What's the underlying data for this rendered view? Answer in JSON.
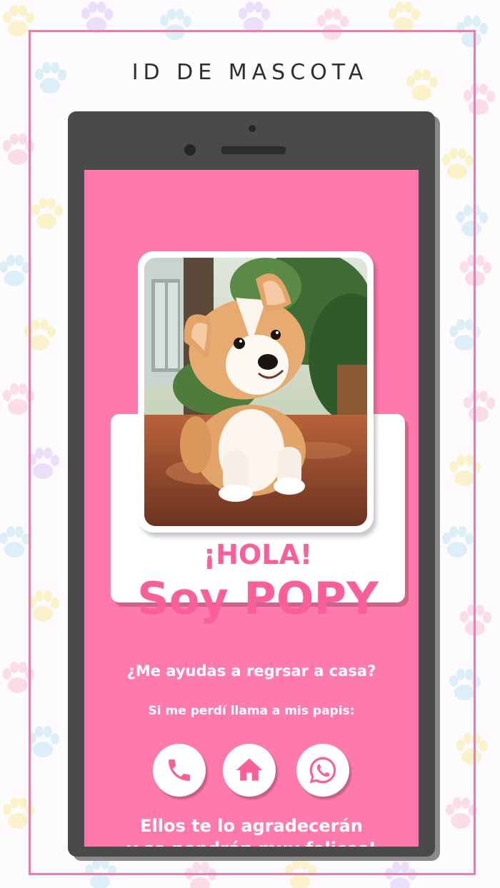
{
  "header": {
    "title": "ID DE MASCOTA"
  },
  "card": {
    "greeting": "¡HOLA!",
    "name": "Soy POPY"
  },
  "message": {
    "question": "¿Me ayudas a regrsar a casa?",
    "call_prompt": "Si me perdí llama a mis papis:",
    "thanks_line1": "Ellos te lo agradecerán",
    "thanks_line2": "y se pondrán muy felices!"
  },
  "icons": [
    "phone-icon",
    "home-icon",
    "whatsapp-icon"
  ],
  "colors": {
    "accent_pink": "#fd7aaa",
    "text_pink": "#f9609a",
    "phone_body": "#4a4a4a",
    "frame_border": "#f07bab"
  }
}
